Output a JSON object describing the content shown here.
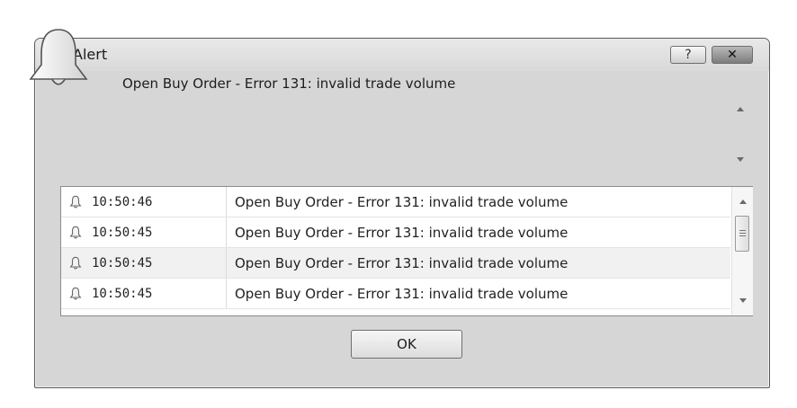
{
  "window": {
    "title": "Alert",
    "title_icon": "bell-icon",
    "help_label": "?",
    "close_label": "✕"
  },
  "alert": {
    "icon": "bell-icon",
    "message": "Open Buy Order - Error 131: invalid trade volume"
  },
  "history": {
    "rows": [
      {
        "time": "10:50:46",
        "message": "Open Buy Order - Error 131: invalid trade volume"
      },
      {
        "time": "10:50:45",
        "message": "Open Buy Order - Error 131: invalid trade volume"
      },
      {
        "time": "10:50:45",
        "message": "Open Buy Order - Error 131: invalid trade volume"
      },
      {
        "time": "10:50:45",
        "message": "Open Buy Order - Error 131: invalid trade volume"
      }
    ]
  },
  "buttons": {
    "ok_label": "OK"
  }
}
